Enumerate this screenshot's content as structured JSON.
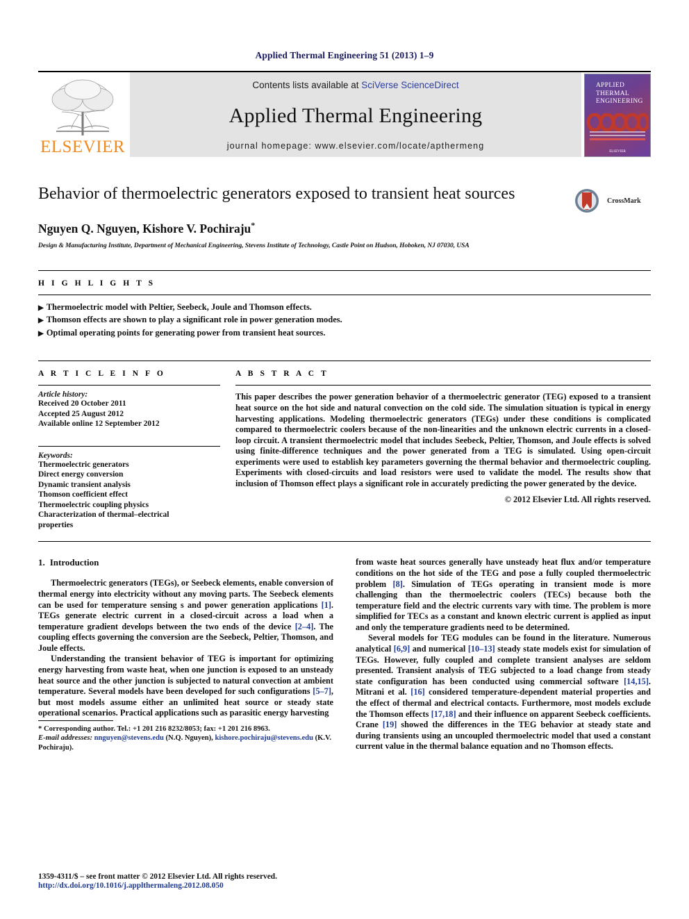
{
  "running_head": "Applied Thermal Engineering 51 (2013) 1–9",
  "masthead": {
    "publisher_name": "ELSEVIER",
    "contents_prefix": "Contents lists available at ",
    "contents_link": "SciVerse ScienceDirect",
    "journal_title": "Applied Thermal Engineering",
    "homepage": "journal homepage: www.elsevier.com/locate/apthermeng",
    "cover_title_line1": "APPLIED",
    "cover_title_line2": "THERMAL",
    "cover_title_line3": "ENGINEERING"
  },
  "article": {
    "title": "Behavior of thermoelectric generators exposed to transient heat sources",
    "crossmark_label": "CrossMark",
    "authors": "Nguyen Q. Nguyen, Kishore V. Pochiraju",
    "author_marker": "*",
    "affiliation": "Design & Manufacturing Institute, Department of Mechanical Engineering, Stevens Institute of Technology, Castle Point on Hudson, Hoboken, NJ 07030, USA"
  },
  "highlights": {
    "label": "H I G H L I G H T S",
    "items": [
      "Thermoelectric model with Peltier, Seebeck, Joule and Thomson effects.",
      "Thomson effects are shown to play a significant role in power generation modes.",
      "Optimal operating points for generating power from transient heat sources."
    ]
  },
  "article_info": {
    "label": "A R T I C L E   I N F O",
    "history_heading": "Article history:",
    "history": [
      "Received 20 October 2011",
      "Accepted 25 August 2012",
      "Available online 12 September 2012"
    ],
    "keywords_heading": "Keywords:",
    "keywords": [
      "Thermoelectric generators",
      "Direct energy conversion",
      "Dynamic transient analysis",
      "Thomson coefficient effect",
      "Thermoelectric coupling physics",
      "Characterization of thermal–electrical",
      "properties"
    ]
  },
  "abstract": {
    "label": "A B S T R A C T",
    "text": "This paper describes the power generation behavior of a thermoelectric generator (TEG) exposed to a transient heat source on the hot side and natural convection on the cold side. The simulation situation is typical in energy harvesting applications. Modeling thermoelectric generators (TEGs) under these conditions is complicated compared to thermoelectric coolers because of the non-linearities and the unknown electric currents in a closed-loop circuit. A transient thermoelectric model that includes Seebeck, Peltier, Thomson, and Joule effects is solved using finite-difference techniques and the power generated from a TEG is simulated. Using open-circuit experiments were used to establish key parameters governing the thermal behavior and thermoelectric coupling. Experiments with closed-circuits and load resistors were used to validate the model. The results show that inclusion of Thomson effect plays a significant role in accurately predicting the power generated by the device.",
    "copyright": "© 2012 Elsevier Ltd. All rights reserved."
  },
  "body": {
    "section_number": "1.",
    "section_title": "Introduction",
    "left_paragraphs": [
      "Thermoelectric generators (TEGs), or Seebeck elements, enable conversion of thermal energy into electricity without any moving parts. The Seebeck elements can be used for temperature sensing s and power generation applications [1]. TEGs generate electric current in a closed-circuit across a load when a temperature gradient develops between the two ends of the device [2–4]. The coupling effects governing the conversion are the Seebeck, Peltier, Thomson, and Joule effects.",
      "Understanding the transient behavior of TEG is important for optimizing energy harvesting from waste heat, when one junction is exposed to an unsteady heat source and the other junction is subjected to natural convection at ambient temperature. Several models have been developed for such configurations [5–7], but most models assume either an unlimited heat source or steady state operational scenarios. Practical applications such as parasitic energy harvesting"
    ],
    "right_paragraphs": [
      "from waste heat sources generally have unsteady heat flux and/or temperature conditions on the hot side of the TEG and pose a fully coupled thermoelectric problem [8]. Simulation of TEGs operating in transient mode is more challenging than the thermoelectric coolers (TECs) because both the temperature field and the electric currents vary with time. The problem is more simplified for TECs as a constant and known electric current is applied as input and only the temperature gradients need to be determined.",
      "Several models for TEG modules can be found in the literature. Numerous analytical [6,9] and numerical [10–13] steady state models exist for simulation of TEGs. However, fully coupled and complete transient analyses are seldom presented. Transient analysis of TEG subjected to a load change from steady state configuration has been conducted using commercial software [14,15]. Mitrani et al. [16] considered temperature-dependent material properties and the effect of thermal and electrical contacts. Furthermore, most models exclude the Thomson effects [17,18] and their influence on apparent Seebeck coefficients. Crane [19] showed the differences in the TEG behavior at steady state and during transients using an uncoupled thermoelectric model that used a constant current value in the thermal balance equation and no Thomson effects."
    ]
  },
  "footnote": {
    "corresponding": "* Corresponding author. Tel.: +1 201 216 8232/8053; fax: +1 201 216 8963.",
    "email_label": "E-mail addresses:",
    "email1": "nnguyen@stevens.edu",
    "email1_owner": "(N.Q. Nguyen),",
    "email2": "kishore.pochiraju@stevens.edu",
    "email2_owner": "(K.V. Pochiraju)."
  },
  "footer": {
    "issn": "1359-4311/$ – see front matter © 2012 Elsevier Ltd. All rights reserved.",
    "doi": "http://dx.doi.org/10.1016/j.applthermaleng.2012.08.050"
  },
  "colors": {
    "link": "#1f3a93",
    "running_head": "#1a1a5e",
    "elsevier_orange": "#f08a22",
    "masthead_bg": "#e3e3e3"
  }
}
